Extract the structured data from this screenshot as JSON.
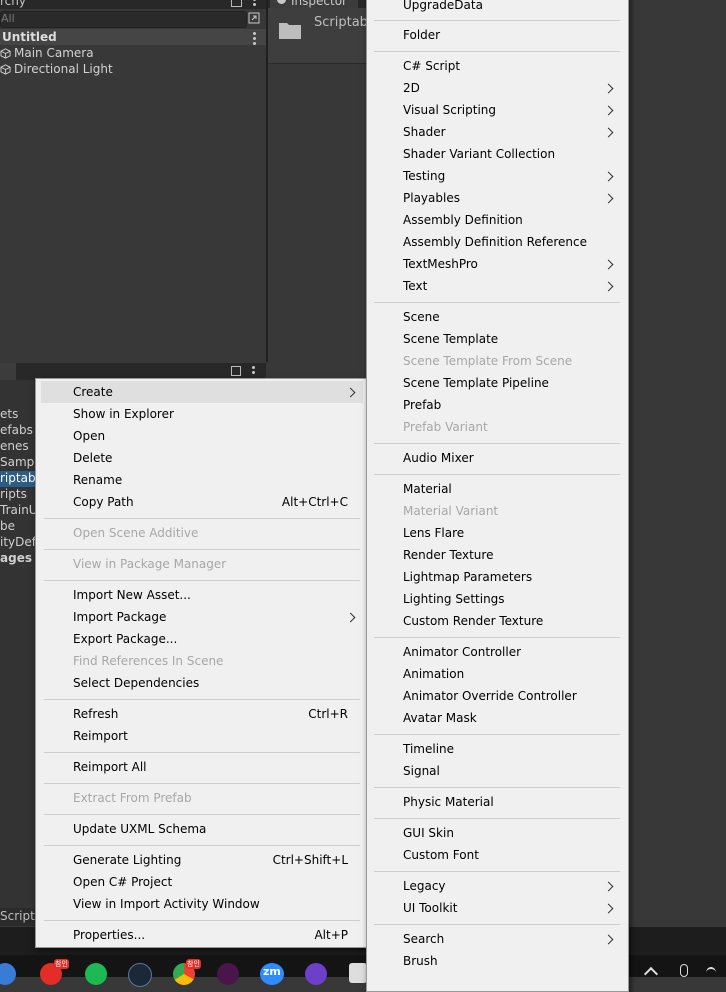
{
  "hierarchy": {
    "tab_label": "rchy",
    "search_placeholder": "All",
    "scene_title": "Untitled",
    "items": [
      "Main Camera",
      "Directional Light"
    ]
  },
  "inspector": {
    "tab_label": "Inspector",
    "asset_title": "Scriptab"
  },
  "project": {
    "tree": [
      "ets",
      "efabs",
      "enes",
      "Sampl",
      "riptabl",
      "ripts",
      "TrainU",
      "be",
      "ityDef",
      "ages"
    ],
    "selected": "riptabl",
    "bottom_path": "Scripta"
  },
  "context_menu": {
    "create": "Create",
    "show_in_explorer": "Show in Explorer",
    "open": "Open",
    "delete": "Delete",
    "rename": "Rename",
    "copy_path": "Copy Path",
    "copy_path_sc": "Alt+Ctrl+C",
    "open_scene_additive": "Open Scene Additive",
    "view_in_package_manager": "View in Package Manager",
    "import_new_asset": "Import New Asset...",
    "import_package": "Import Package",
    "export_package": "Export Package...",
    "find_references": "Find References In Scene",
    "select_dependencies": "Select Dependencies",
    "refresh": "Refresh",
    "refresh_sc": "Ctrl+R",
    "reimport": "Reimport",
    "reimport_all": "Reimport All",
    "extract_from_prefab": "Extract From Prefab",
    "update_uxml": "Update UXML Schema",
    "generate_lighting": "Generate Lighting",
    "generate_lighting_sc": "Ctrl+Shift+L",
    "open_csharp_project": "Open C# Project",
    "view_import_activity": "View in Import Activity Window",
    "properties": "Properties...",
    "properties_sc": "Alt+P"
  },
  "create_submenu": {
    "upgrade_data": "UpgradeData",
    "folder": "Folder",
    "csharp_script": "C# Script",
    "two_d": "2D",
    "visual_scripting": "Visual Scripting",
    "shader": "Shader",
    "shader_variant_collection": "Shader Variant Collection",
    "testing": "Testing",
    "playables": "Playables",
    "assembly_definition": "Assembly Definition",
    "assembly_definition_reference": "Assembly Definition Reference",
    "textmeshpro": "TextMeshPro",
    "text": "Text",
    "scene": "Scene",
    "scene_template": "Scene Template",
    "scene_template_from_scene": "Scene Template From Scene",
    "scene_template_pipeline": "Scene Template Pipeline",
    "prefab": "Prefab",
    "prefab_variant": "Prefab Variant",
    "audio_mixer": "Audio Mixer",
    "material": "Material",
    "material_variant": "Material Variant",
    "lens_flare": "Lens Flare",
    "render_texture": "Render Texture",
    "lightmap_parameters": "Lightmap Parameters",
    "lighting_settings": "Lighting Settings",
    "custom_render_texture": "Custom Render Texture",
    "animator_controller": "Animator Controller",
    "animation": "Animation",
    "animator_override_controller": "Animator Override Controller",
    "avatar_mask": "Avatar Mask",
    "timeline": "Timeline",
    "signal": "Signal",
    "physic_material": "Physic Material",
    "gui_skin": "GUI Skin",
    "custom_font": "Custom Font",
    "legacy": "Legacy",
    "ui_toolkit": "UI Toolkit",
    "search": "Search",
    "brush": "Brush"
  },
  "taskbar": {
    "badge": "참인",
    "zoom_label": "zm"
  },
  "colors": {
    "editor_bg": "#383838",
    "menu_bg": "#f0f0f0",
    "disabled_text": "#a7a7a7",
    "selection": "#2c5d87"
  }
}
